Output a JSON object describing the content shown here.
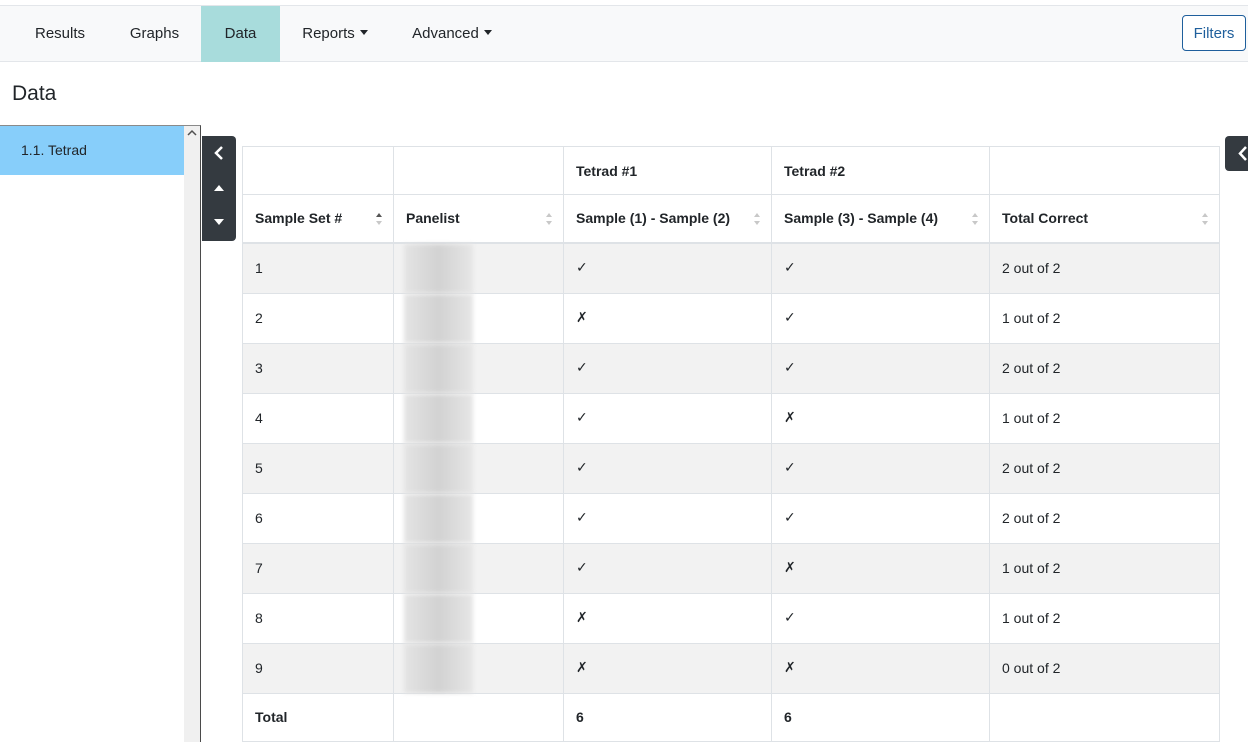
{
  "nav": {
    "tabs": [
      {
        "label": "Results",
        "active": false,
        "dropdown": false
      },
      {
        "label": "Graphs",
        "active": false,
        "dropdown": false
      },
      {
        "label": "Data",
        "active": true,
        "dropdown": false
      },
      {
        "label": "Reports",
        "active": false,
        "dropdown": true
      },
      {
        "label": "Advanced",
        "active": false,
        "dropdown": true
      }
    ],
    "filters_label": "Filters"
  },
  "page": {
    "title": "Data"
  },
  "sidebar": {
    "items": [
      {
        "label": "1.1. Tetrad",
        "selected": true
      }
    ]
  },
  "table": {
    "group_headers": [
      "",
      "",
      "Tetrad #1",
      "Tetrad #2",
      ""
    ],
    "columns": [
      "Sample Set #",
      "Panelist",
      "Sample (1) - Sample (2)",
      "Sample (3) - Sample (4)",
      "Total Correct"
    ],
    "rows": [
      {
        "set": "1",
        "panelist": "",
        "t1": "✓",
        "t2": "✓",
        "total": "2 out of 2"
      },
      {
        "set": "2",
        "panelist": "",
        "t1": "✗",
        "t2": "✓",
        "total": "1 out of 2"
      },
      {
        "set": "3",
        "panelist": "",
        "t1": "✓",
        "t2": "✓",
        "total": "2 out of 2"
      },
      {
        "set": "4",
        "panelist": "",
        "t1": "✓",
        "t2": "✗",
        "total": "1 out of 2"
      },
      {
        "set": "5",
        "panelist": "",
        "t1": "✓",
        "t2": "✓",
        "total": "2 out of 2"
      },
      {
        "set": "6",
        "panelist": "",
        "t1": "✓",
        "t2": "✓",
        "total": "2 out of 2"
      },
      {
        "set": "7",
        "panelist": "",
        "t1": "✓",
        "t2": "✗",
        "total": "1 out of 2"
      },
      {
        "set": "8",
        "panelist": "",
        "t1": "✗",
        "t2": "✓",
        "total": "1 out of 2"
      },
      {
        "set": "9",
        "panelist": "",
        "t1": "✗",
        "t2": "✗",
        "total": "0 out of 2"
      }
    ],
    "footer": {
      "label": "Total",
      "panelist": "",
      "t1": "6",
      "t2": "6",
      "total": ""
    }
  },
  "colors": {
    "active_tab": "#a8dcdc",
    "selected_item": "#87cefa",
    "filters_border": "#1f5f9c",
    "side_controls": "#343a40"
  },
  "icons": {
    "collapse_left": "chevron-left-icon",
    "move_up": "caret-up-icon",
    "move_down": "caret-down-icon",
    "sort": "sort-arrows-icon"
  }
}
